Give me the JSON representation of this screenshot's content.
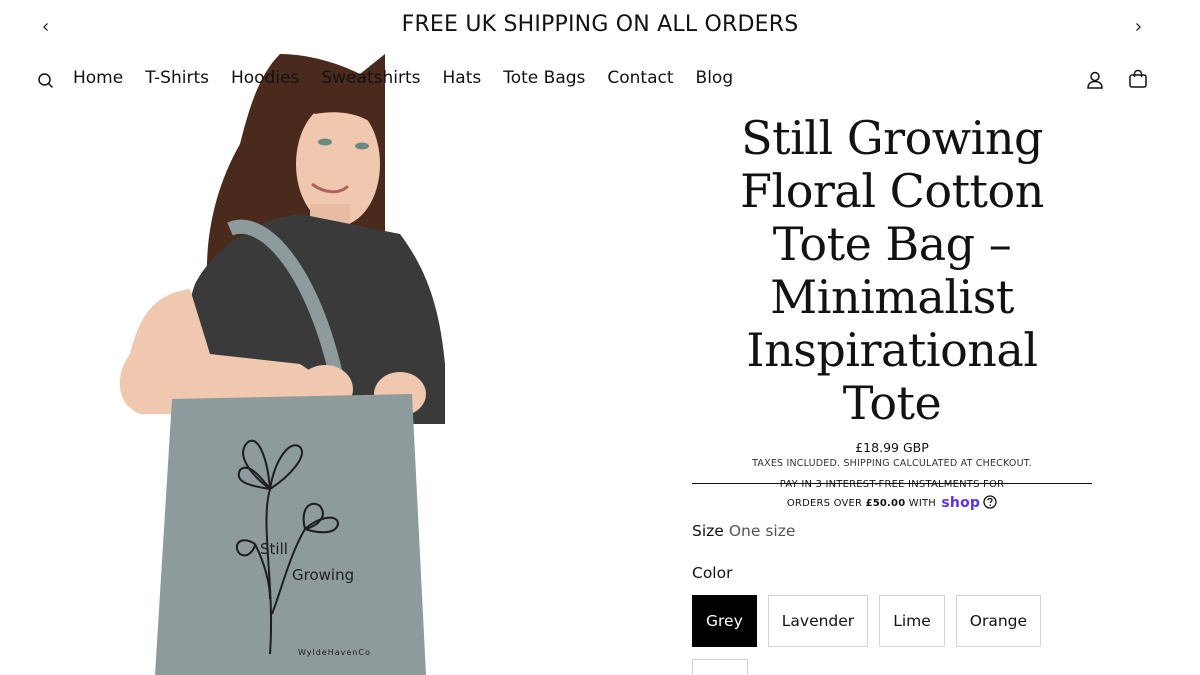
{
  "announcement": {
    "text": "FREE UK SHIPPING ON ALL ORDERS",
    "prev_icon": "chevron-left-icon",
    "next_icon": "chevron-right-icon"
  },
  "nav": {
    "items": [
      "Home",
      "T-Shirts",
      "Hoodies",
      "Sweatshirts",
      "Hats",
      "Tote Bags",
      "Contact",
      "Blog"
    ],
    "icons": [
      "search-icon",
      "account-icon",
      "cart-icon"
    ]
  },
  "product": {
    "title": "Still Growing Floral Cotton Tote Bag – Minimalist Inspirational Tote",
    "price": "£18.99 GBP",
    "taxes_note": "TAXES INCLUDED. SHIPPING CALCULATED AT CHECKOUT.",
    "installments_line1": "PAY IN 3 INTEREST-FREE INSTALMENTS FOR",
    "installments_prefix": "ORDERS OVER ",
    "installments_amount": "£50.00",
    "installments_suffix": " WITH ",
    "shop_logo": "shop",
    "image": {
      "bag_text_1": "Still",
      "bag_text_2": "Growing",
      "bag_brand": "WyldeHavenCo"
    },
    "size_label": "Size",
    "size_value": "One size",
    "color_label": "Color",
    "colors": [
      "Grey",
      "Lavender",
      "Lime",
      "Orange"
    ],
    "selected_color": "Grey"
  },
  "colors": {
    "text": "#121212",
    "shop_brand": "#5a31f4",
    "selected_swatch": "#000000",
    "bag": "#8e9b9c"
  }
}
